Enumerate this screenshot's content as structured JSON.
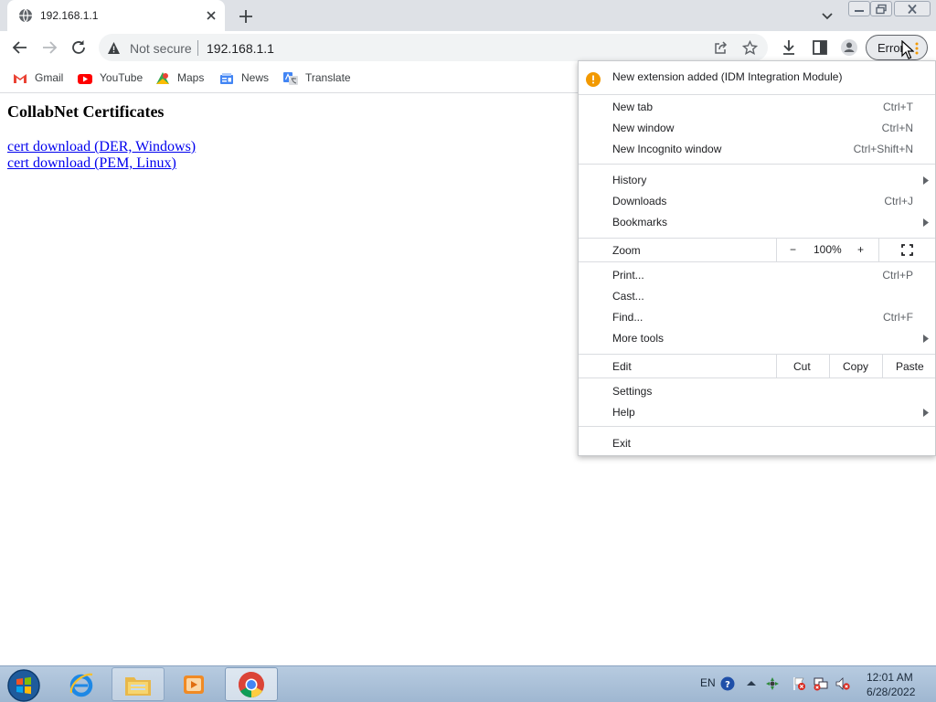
{
  "tab": {
    "title": "192.168.1.1"
  },
  "toolbar": {
    "security_label": "Not secure",
    "url": "192.168.1.1",
    "profile_chip_label": "Error"
  },
  "bookmarks": [
    {
      "label": "Gmail",
      "icon": "gmail-icon"
    },
    {
      "label": "YouTube",
      "icon": "youtube-icon"
    },
    {
      "label": "Maps",
      "icon": "maps-icon"
    },
    {
      "label": "News",
      "icon": "news-icon"
    },
    {
      "label": "Translate",
      "icon": "translate-icon"
    }
  ],
  "page": {
    "heading": "CollabNet Certificates",
    "links": [
      "cert download (DER, Windows)",
      "cert download (PEM, Linux)"
    ]
  },
  "menu": {
    "notice": "New extension added (IDM Integration Module)",
    "new_tab": {
      "label": "New tab",
      "shortcut": "Ctrl+T"
    },
    "new_window": {
      "label": "New window",
      "shortcut": "Ctrl+N"
    },
    "new_incognito": {
      "label": "New Incognito window",
      "shortcut": "Ctrl+Shift+N"
    },
    "history": {
      "label": "History"
    },
    "downloads": {
      "label": "Downloads",
      "shortcut": "Ctrl+J"
    },
    "bookmarks": {
      "label": "Bookmarks"
    },
    "zoom": {
      "label": "Zoom",
      "minus": "−",
      "value": "100%",
      "plus": "+"
    },
    "print": {
      "label": "Print...",
      "shortcut": "Ctrl+P"
    },
    "cast": {
      "label": "Cast..."
    },
    "find": {
      "label": "Find...",
      "shortcut": "Ctrl+F"
    },
    "more_tools": {
      "label": "More tools"
    },
    "edit": {
      "label": "Edit",
      "cut": "Cut",
      "copy": "Copy",
      "paste": "Paste"
    },
    "settings": {
      "label": "Settings"
    },
    "help": {
      "label": "Help"
    },
    "exit": {
      "label": "Exit"
    }
  },
  "taskbar": {
    "language": "EN",
    "time": "12:01 AM",
    "date": "6/28/2022"
  },
  "colors": {
    "link": "#0000ee",
    "notice_icon": "#f29900",
    "taskbar": "#b7cbe0"
  }
}
